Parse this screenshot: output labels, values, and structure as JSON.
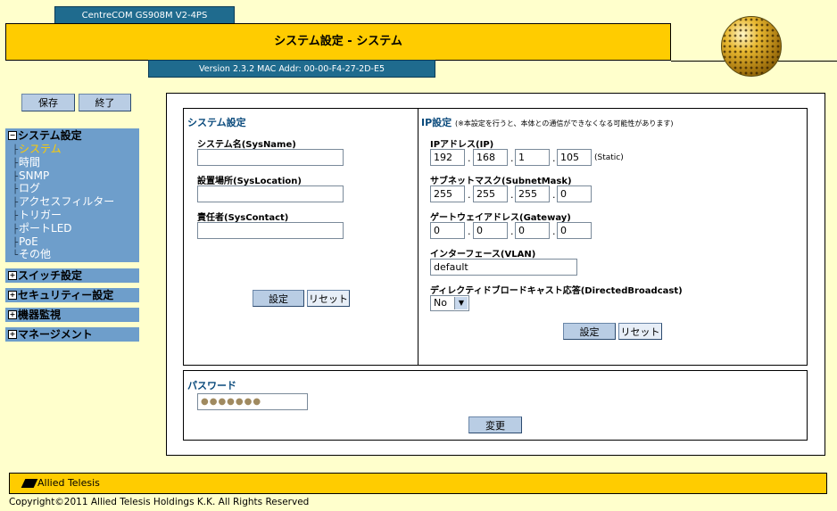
{
  "header": {
    "model": "CentreCOM GS908M V2-4PS",
    "title": "システム設定 - システム",
    "version_line": "Version 2.3.2 MAC Addr: 00-00-F4-27-2D-E5"
  },
  "toolbar": {
    "save_label": "保存",
    "exit_label": "終了"
  },
  "nav": {
    "system_label": "システム設定",
    "system_items": [
      "システム",
      "時間",
      "SNMP",
      "ログ",
      "アクセスフィルター",
      "トリガー",
      "ポートLED",
      "PoE",
      "その他"
    ],
    "active_item": "システム",
    "switch_label": "スイッチ設定",
    "security_label": "セキュリティー設定",
    "monitor_label": "機器監視",
    "management_label": "マネージメント",
    "tree_collapse_symbol": "−",
    "tree_expand_symbol": "+",
    "tree_branch_symbol": "├",
    "tree_end_symbol": "└"
  },
  "system_settings": {
    "title": "システム設定",
    "sysname_label": "システム名(SysName)",
    "sysname_value": "",
    "syslocation_label": "設置場所(SysLocation)",
    "syslocation_value": "",
    "syscontact_label": "責任者(SysContact)",
    "syscontact_value": "",
    "set_button": "設定",
    "reset_button": "リセット"
  },
  "ip_settings": {
    "title": "IP設定",
    "note": "(※本設定を行うと、本体との通信ができなくなる可能性があります)",
    "ip_label": "IPアドレス(IP)",
    "ip": [
      "192",
      "168",
      "1",
      "105"
    ],
    "ip_mode": "(Static)",
    "mask_label": "サブネットマスク(SubnetMask)",
    "mask": [
      "255",
      "255",
      "255",
      "0"
    ],
    "gateway_label": "ゲートウェイアドレス(Gateway)",
    "gateway": [
      "0",
      "0",
      "0",
      "0"
    ],
    "octet_separator": ".",
    "vlan_label": "インターフェース(VLAN)",
    "vlan_value": "default",
    "broadcast_label": "ディレクティドブロードキャスト応答(DirectedBroadcast)",
    "broadcast_value": "No",
    "dropdown_symbol": "▼",
    "set_button": "設定",
    "reset_button": "リセット"
  },
  "password": {
    "title": "パスワード",
    "masked_value": "●●●●●●●",
    "change_button": "変更"
  },
  "footer": {
    "logo_text": "Allied Telesis",
    "copyright": "Copyright©2011 Allied Telesis Holdings K.K. All Rights Reserved"
  },
  "colors": {
    "background": "#ffffcc",
    "accent_yellow": "#ffcc00",
    "header_blue": "#1f6b8e",
    "nav_blue": "#6e9ecb",
    "section_title": "#0a4a7c",
    "active_nav": "#ffcc00"
  }
}
